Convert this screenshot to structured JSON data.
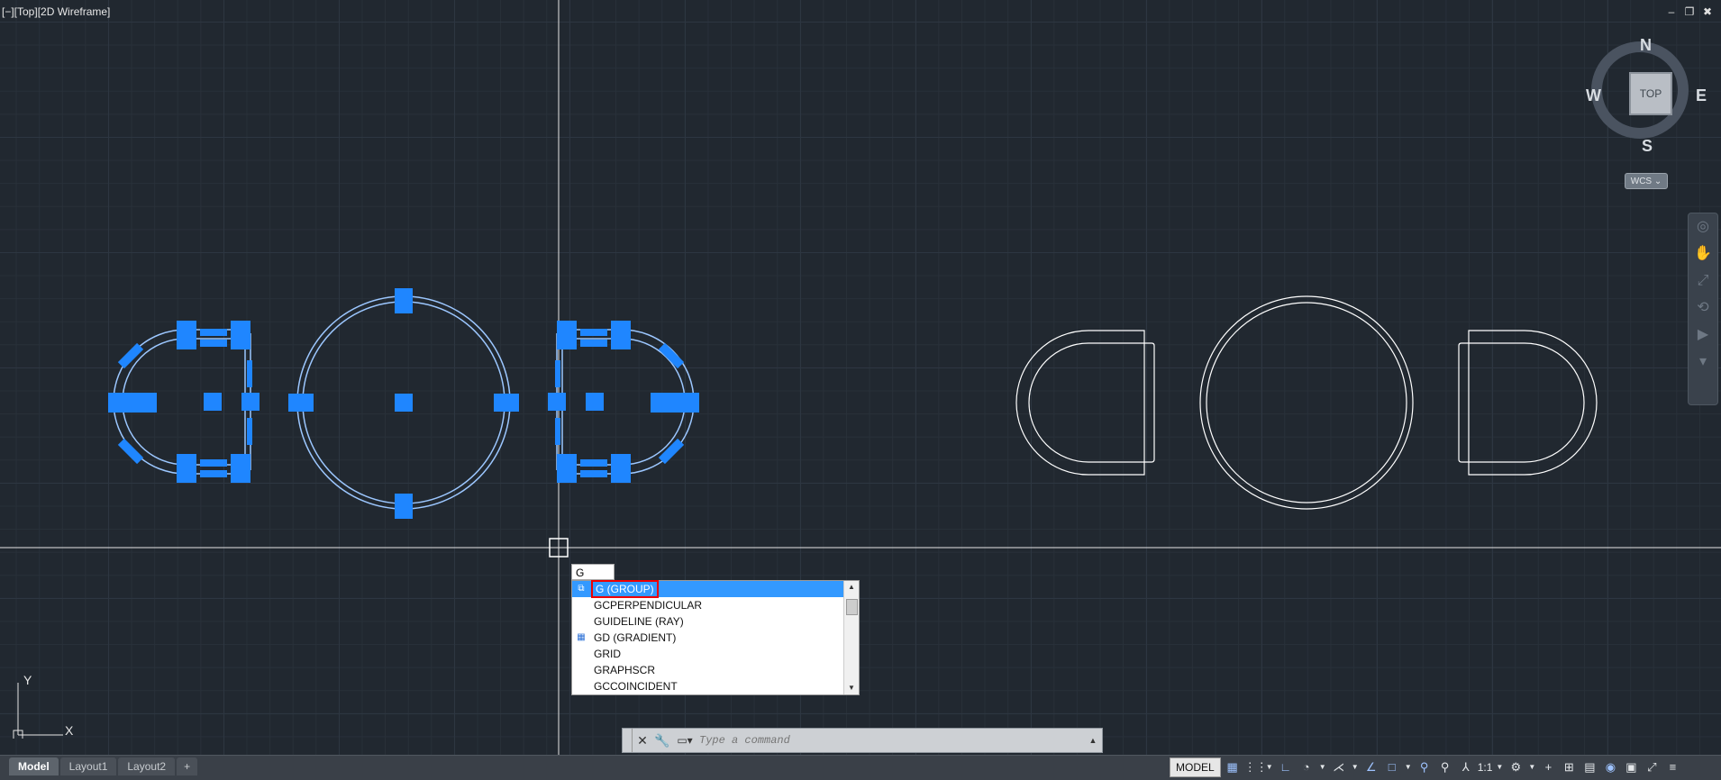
{
  "viewport": {
    "label": "[−][Top][2D Wireframe]",
    "window_controls": [
      "–",
      "❐",
      "✖"
    ]
  },
  "viewcube": {
    "face": "TOP",
    "north": "N",
    "south": "S",
    "east": "E",
    "west": "W",
    "wcs_label": "WCS ⌄"
  },
  "ucs": {
    "x_label": "X",
    "y_label": "Y"
  },
  "command": {
    "typed_value": "G",
    "autocomplete": [
      {
        "label": "G (GROUP)",
        "icon": "group-icon",
        "selected": true
      },
      {
        "label": "GCPERPENDICULAR",
        "icon": "",
        "selected": false
      },
      {
        "label": "GUIDELINE (RAY)",
        "icon": "",
        "selected": false
      },
      {
        "label": "GD (GRADIENT)",
        "icon": "gradient-icon",
        "selected": false
      },
      {
        "label": "GRID",
        "icon": "",
        "selected": false
      },
      {
        "label": "GRAPHSCR",
        "icon": "",
        "selected": false
      },
      {
        "label": "GCCOINCIDENT",
        "icon": "",
        "selected": false
      }
    ],
    "placeholder": "Type a command"
  },
  "layout_tabs": [
    "Model",
    "Layout1",
    "Layout2",
    "+"
  ],
  "status": {
    "model_label": "MODEL",
    "scale": "1:1"
  },
  "colors": {
    "background": "#212830",
    "selection_blue": "#1f86ff",
    "geometry_white": "#ffffff",
    "highlight": "#3399ff"
  }
}
